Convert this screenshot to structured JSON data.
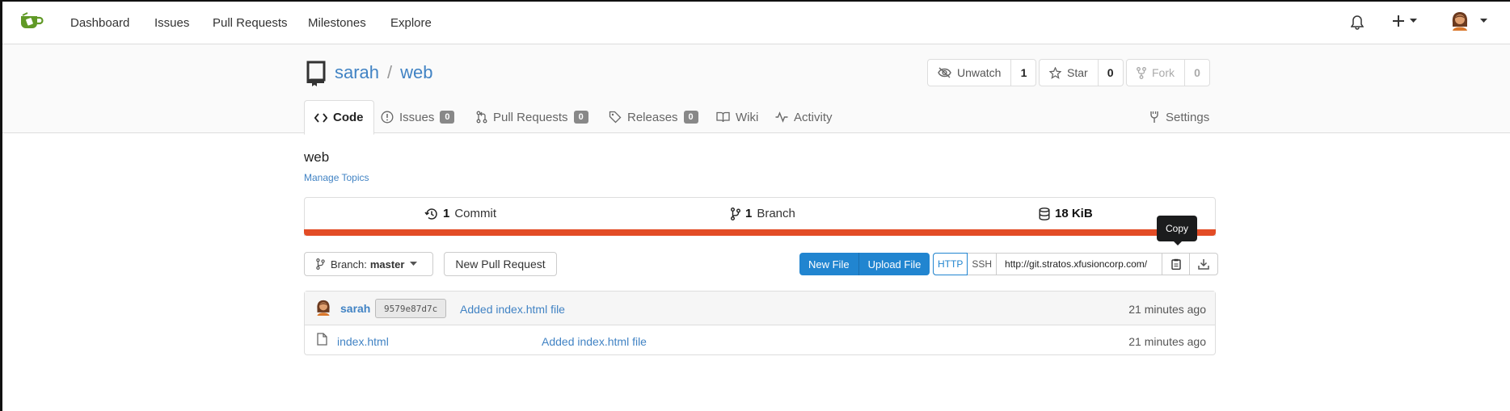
{
  "nav": {
    "items": [
      "Dashboard",
      "Issues",
      "Pull Requests",
      "Milestones",
      "Explore"
    ],
    "icons": [
      "bell-icon",
      "plus-icon",
      "avatar"
    ]
  },
  "repo": {
    "owner": "sarah",
    "separator": "/",
    "name": "web",
    "watch": {
      "label": "Unwatch",
      "count": "1"
    },
    "star": {
      "label": "Star",
      "count": "0"
    },
    "fork": {
      "label": "Fork",
      "count": "0"
    }
  },
  "tabs": [
    {
      "label": "Code",
      "badge": ""
    },
    {
      "label": "Issues",
      "badge": "0"
    },
    {
      "label": "Pull Requests",
      "badge": "0"
    },
    {
      "label": "Releases",
      "badge": "0"
    },
    {
      "label": "Wiki",
      "badge": ""
    },
    {
      "label": "Activity",
      "badge": ""
    }
  ],
  "settings_label": "Settings",
  "description": "web",
  "manage_topics": "Manage Topics",
  "stats": {
    "commits_count": "1",
    "commits_label": "Commit",
    "branches_count": "1",
    "branches_label": "Branch",
    "size": "18 KiB"
  },
  "language_color": "#e34c26",
  "toolbar": {
    "branch_prefix": "Branch:",
    "branch_name": "master",
    "new_pr": "New Pull Request",
    "new_file": "New File",
    "upload_file": "Upload File",
    "http": "HTTP",
    "ssh": "SSH",
    "clone_url": "http://git.stratos.xfusioncorp.com/",
    "copy_tooltip": "Copy"
  },
  "latest_commit": {
    "author": "sarah",
    "sha": "9579e87d7c",
    "message": "Added index.html file",
    "time": "21 minutes ago"
  },
  "files": [
    {
      "name": "index.html",
      "message": "Added index.html file",
      "time": "21 minutes ago"
    }
  ]
}
